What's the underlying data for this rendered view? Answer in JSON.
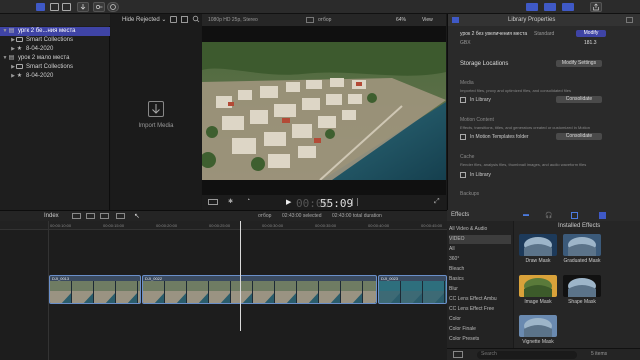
{
  "toolbar": {},
  "browser": {
    "filter_label": "Hide Rejected",
    "items": [
      {
        "label": "ургк 2 бе...ния места",
        "level": 0,
        "type": "library",
        "selected": true
      },
      {
        "label": "Smart Collections",
        "level": 1,
        "type": "folder",
        "selected": false
      },
      {
        "label": "8-04-2020",
        "level": 1,
        "type": "event",
        "selected": false
      },
      {
        "label": "урок 2 мало места",
        "level": 0,
        "type": "library",
        "selected": false
      },
      {
        "label": "Smart Collections",
        "level": 1,
        "type": "folder",
        "selected": false
      },
      {
        "label": "8-04-2020",
        "level": 1,
        "type": "event",
        "selected": false
      }
    ],
    "import_label": "Import Media"
  },
  "viewer": {
    "format": "1080p HD 25p, Stereo",
    "project": "отбор",
    "zoom": "64%",
    "view_label": "View",
    "timecode_dim": "00:00",
    "timecode": "55:09"
  },
  "inspector": {
    "title": "Library Properties",
    "library_name": "урок 2 без увеличения места",
    "library_kind": "Standard",
    "modify_label": "Modify",
    "gbx": "GBX",
    "size": "181.3",
    "storage_heading": "Storage Locations",
    "modify_settings": "Modify Settings",
    "media_heading": "Media",
    "media_desc": "Imported files, proxy and optimized files, and consolidated files",
    "in_library": "In Library",
    "consolidate": "Consolidate",
    "motion_heading": "Motion Content",
    "motion_desc": "Effects, transitions, titles, and generators created or customized in Motion",
    "motion_location": "In Motion Templates folder",
    "cache_heading": "Cache",
    "cache_desc": "Render files, analysis files, thumbnail images, and audio waveform files",
    "cache_location": "In Library",
    "backups_heading": "Backups"
  },
  "timeline": {
    "index_label": "Index",
    "project": "отбор",
    "selection": "02:43:00 selected",
    "total": "02:43:00 total duration",
    "ruler": [
      "00:00:10:00",
      "00:00:15:00",
      "00:00:20:00",
      "00:00:25:00",
      "00:00:30:00",
      "00:00:35:00",
      "00:00:40:00",
      "00:00:45:00"
    ],
    "clips": [
      {
        "label": "DJI_0013"
      },
      {
        "label": "DJI_0022"
      },
      {
        "label": "DJI_0023"
      }
    ]
  },
  "effects": {
    "heading": "Effects",
    "installed": "Installed Effects",
    "categories": [
      "All Video & Audio",
      "VIDEO",
      "All",
      "360°",
      "Bleach",
      "Basics",
      "Blur",
      "CC Lens Effect Ambu",
      "CC Lens Effect Free",
      "Color",
      "Color Finale",
      "Color Presets"
    ],
    "selected_category": 1,
    "items": [
      {
        "name": "Draw Mask"
      },
      {
        "name": "Graduated Mask"
      },
      {
        "name": "Image Mask"
      },
      {
        "name": "Shape Mask"
      },
      {
        "name": "Vignette Mask"
      }
    ],
    "search_placeholder": "Search",
    "count": "5 items"
  },
  "colors": {
    "accent": "#3f44a6",
    "clip_border": "#6a8fc9",
    "playhead": "#d9d9d9"
  }
}
